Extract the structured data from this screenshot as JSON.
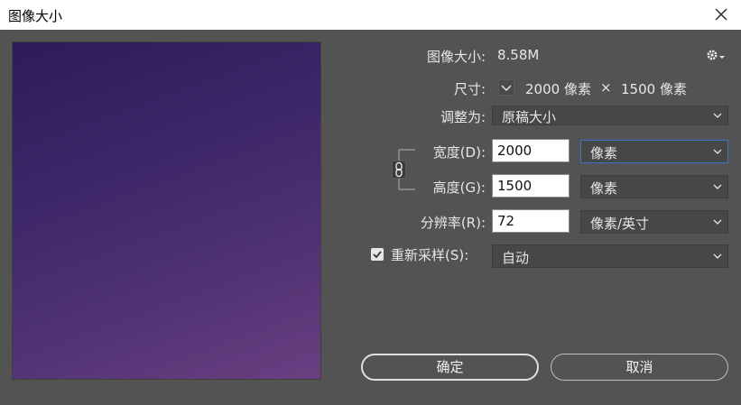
{
  "window": {
    "title": "图像大小"
  },
  "image_size": {
    "label": "图像大小:",
    "value": "8.58M"
  },
  "dimensions": {
    "label": "尺寸:",
    "width_value": "2000 像素",
    "times": "×",
    "height_value": "1500 像素"
  },
  "fit_to": {
    "label": "调整为:",
    "selected": "原稿大小"
  },
  "width": {
    "label": "宽度(D):",
    "value": "2000",
    "unit": "像素"
  },
  "height": {
    "label": "高度(G):",
    "value": "1500",
    "unit": "像素"
  },
  "resolution": {
    "label": "分辨率(R):",
    "value": "72",
    "unit": "像素/英寸"
  },
  "resample": {
    "label": "重新采样(S):",
    "checked": true,
    "selected": "自动"
  },
  "buttons": {
    "ok": "确定",
    "cancel": "取消"
  },
  "icons": {
    "close": "close-icon",
    "gear": "gear-icon",
    "chain": "chain-link-icon",
    "dims_toggle": "chevron-down-icon"
  },
  "colors": {
    "focus_border": "#3a73c6",
    "background": "#535353"
  }
}
